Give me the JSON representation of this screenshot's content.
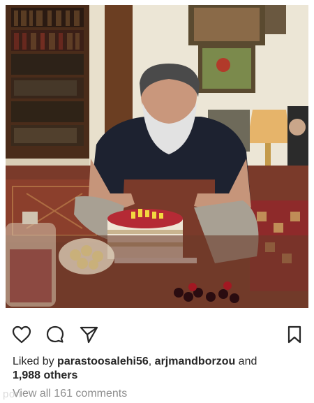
{
  "post": {
    "photo_alt": "post-photo",
    "liked_by_prefix": "Liked by ",
    "liked_user_1": "parastoosalehi56",
    "separator": ", ",
    "liked_user_2": "arjmandborzou",
    "and_word": " and",
    "others_count": "1,988 others",
    "view_comments": "View all 161 comments",
    "watermark": "pon"
  },
  "actions": {
    "like_icon": "heart-outline-icon",
    "comment_icon": "comment-bubble-icon",
    "share_icon": "paper-plane-icon",
    "save_icon": "bookmark-outline-icon"
  },
  "colors": {
    "text": "#262626",
    "muted": "#8e8e8e",
    "background": "#ffffff"
  }
}
